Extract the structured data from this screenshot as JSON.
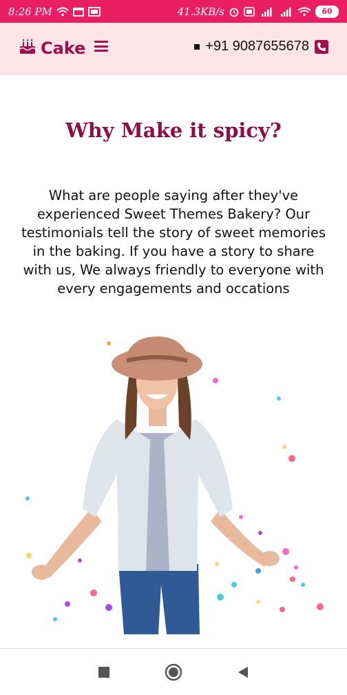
{
  "status_bar": {
    "time": "8:26 PM",
    "speed": "41.3KB/s",
    "battery": "60",
    "background": "#e91e63"
  },
  "header": {
    "brand": "Cake",
    "phone": "+91 9087655678",
    "accent": "#a0104a",
    "background": "#fde4e9"
  },
  "section": {
    "title": "Why Make it spicy?",
    "body": "What are people saying after they've experienced Sweet Themes Bakery? Our testimonials tell the story of sweet memories in the baking. If you have a story to share with us, We always friendly to everyone with every engagements and occations"
  },
  "icons": {
    "brand": "cake-icon",
    "menu": "hamburger-menu-icon",
    "phone": "phone-icon",
    "nav_recent": "square-recent-apps-icon",
    "nav_home": "circle-home-icon",
    "nav_back": "triangle-back-icon"
  }
}
